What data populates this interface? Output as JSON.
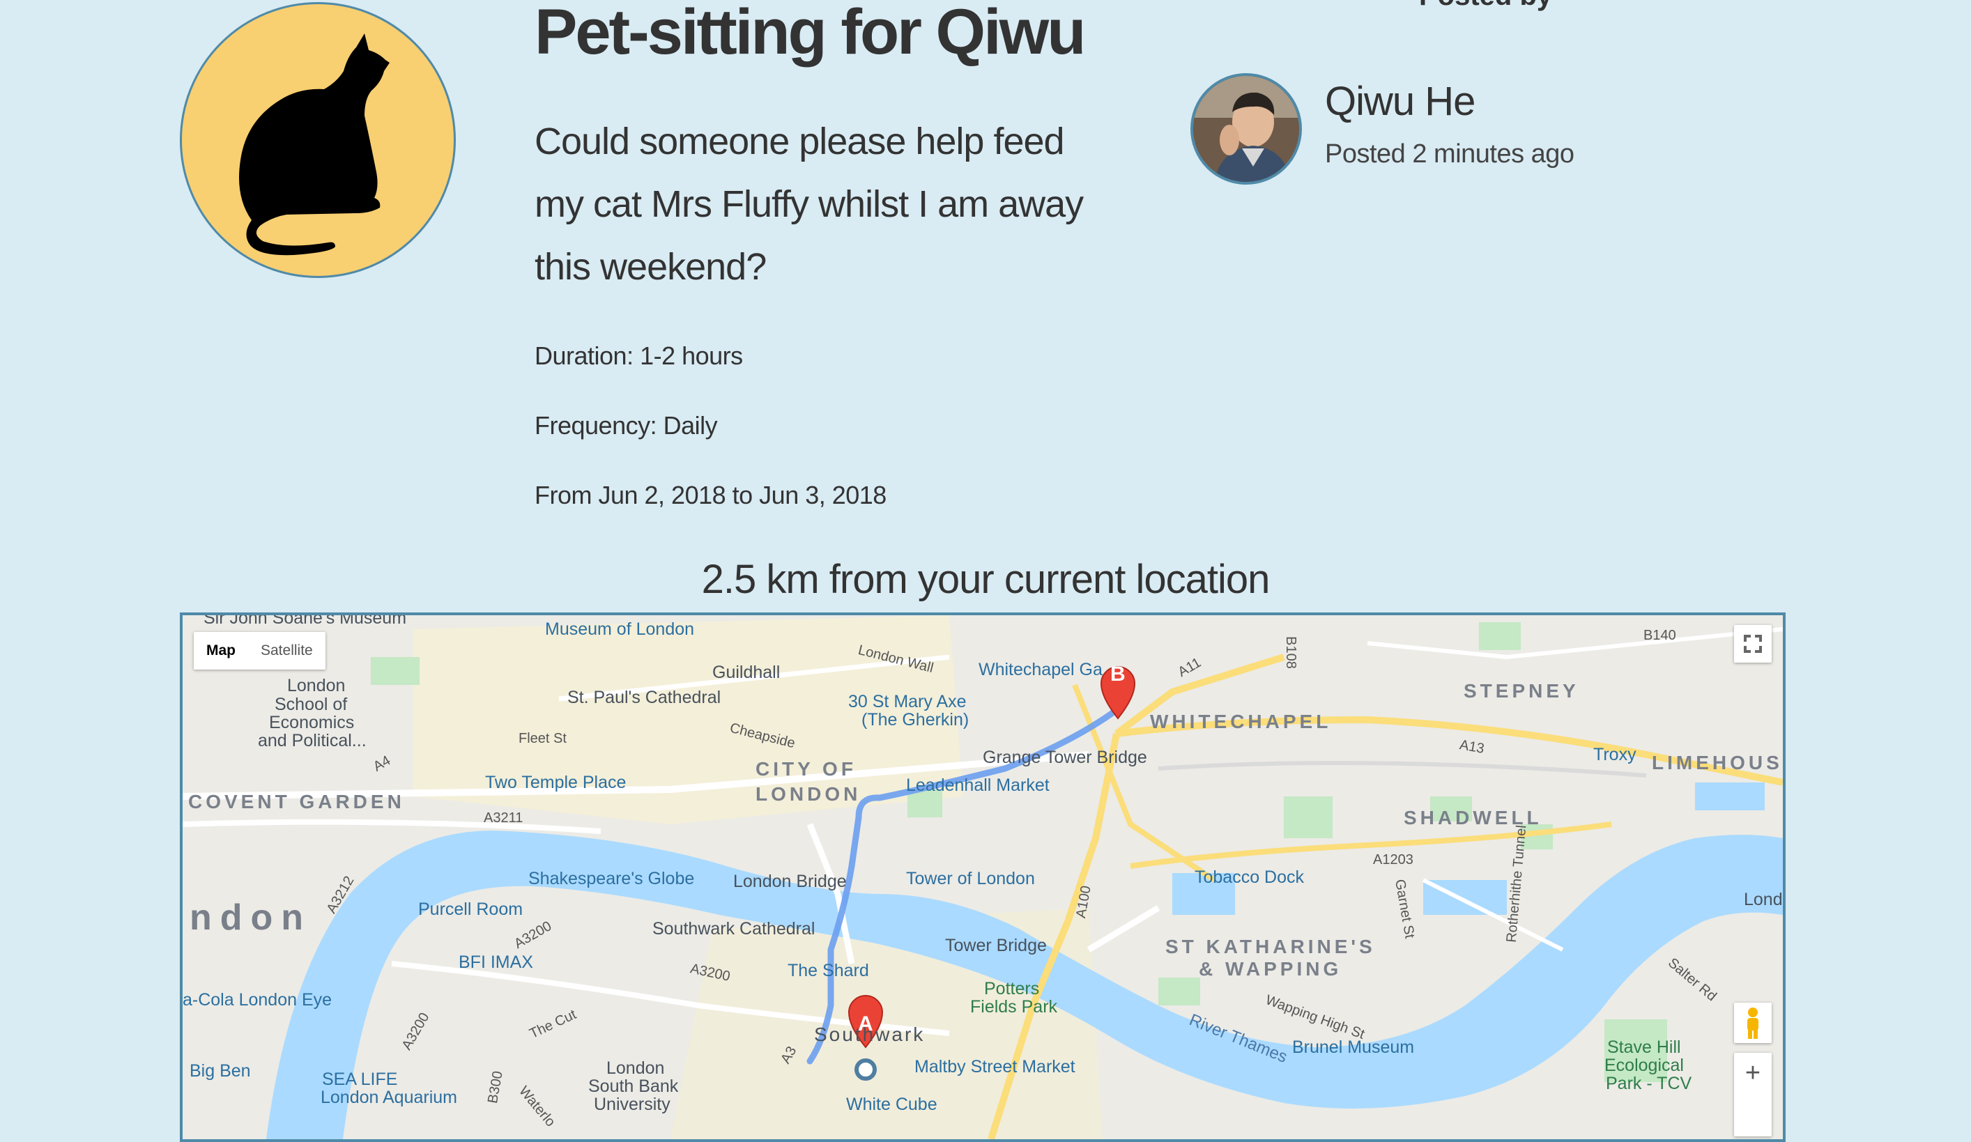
{
  "post": {
    "title": "Pet-sitting for Qiwu",
    "description": "Could someone please help feed my cat Mrs Fluffy whilst I am away this weekend?",
    "duration": "Duration: 1-2 hours",
    "frequency": "Frequency: Daily",
    "dates": "From Jun 2, 2018 to Jun 3, 2018",
    "icon": "cat-icon"
  },
  "poster": {
    "label": "Posted by",
    "name": "Qiwu He",
    "posted_time": "Posted 2 minutes ago"
  },
  "distance_text": "2.5 km from your current location",
  "map": {
    "type_buttons": [
      "Map",
      "Satellite"
    ],
    "active_type": "Map",
    "markers": {
      "start": "A",
      "end": "B"
    },
    "zoom_in": "+",
    "districts": {
      "city_of_london_1": "CITY OF",
      "city_of_london_2": "LONDON",
      "covent_garden": "COVENT GARDEN",
      "whitechapel": "WHITECHAPEL",
      "stepney": "STEPNEY",
      "limehouse": "LIMEHOUSE",
      "shadwell": "SHADWELL",
      "st_katharines_1": "ST KATHARINE'S",
      "st_katharines_2": "& WAPPING",
      "london_partial": "ndon"
    },
    "pois": {
      "soane": "Sir John Soane's Museum",
      "museum_of_london": "Museum of London",
      "guildhall": "Guildhall",
      "lse_1": "London",
      "lse_2": "School of",
      "lse_3": "Economics",
      "lse_4": "and Political...",
      "st_pauls": "St. Paul's Cathedral",
      "gherkin_1": "30 St Mary Axe",
      "gherkin_2": "(The Gherkin)",
      "whitechapel_gallery": "Whitechapel Ga",
      "two_temple": "Two Temple Place",
      "leadenhall": "Leadenhall Market",
      "grange": "Grange Tower Bridge",
      "troxy": "Troxy",
      "shakespeare": "Shakespeare's Globe",
      "london_bridge": "London Bridge",
      "tower_of_london": "Tower of London",
      "tobacco_dock": "Tobacco Dock",
      "purcell": "Purcell Room",
      "southwark_cathedral": "Southwark Cathedral",
      "tower_bridge": "Tower Bridge",
      "bfi": "BFI IMAX",
      "shard": "The Shard",
      "potters_1": "Potters",
      "potters_2": "Fields Park",
      "london_eye": "a-Cola London Eye",
      "brunel": "Brunel Museum",
      "stave_1": "Stave Hill",
      "stave_2": "Ecological",
      "stave_3": "Park - TCV",
      "big_ben": "Big Ben",
      "sealife_1": "SEA LIFE",
      "sealife_2": "London Aquarium",
      "lsbu_1": "London",
      "lsbu_2": "South Bank",
      "lsbu_3": "University",
      "maltby": "Maltby Street Market",
      "white_cube": "White Cube",
      "southwark": "Southwark",
      "london_right": "Londo"
    },
    "roads": {
      "london_wall": "London Wall",
      "fleet_st": "Fleet St",
      "cheapside": "Cheapside",
      "a11": "A11",
      "b108": "B108",
      "b140": "B140",
      "a13": "A13",
      "a4": "A4",
      "a3211": "A3211",
      "a1203": "A1203",
      "a100": "A100",
      "garnet": "Garnet St",
      "rotherhithe": "Rotherhithe Tunnel",
      "a3200_1": "A3200",
      "a3200_2": "A3200",
      "a3200_3": "A3200",
      "a3212": "A3212",
      "the_cut": "The Cut",
      "wapping_high": "Wapping High St",
      "river_thames": "River Thames",
      "salter": "Salter Rd",
      "a3": "A3",
      "b300": "B300",
      "waterloo": "Waterlo"
    },
    "colors": {
      "water": "#aadaff",
      "route": "#6c9ef0",
      "marker": "#ea4335",
      "park": "#c5e8c5"
    }
  }
}
